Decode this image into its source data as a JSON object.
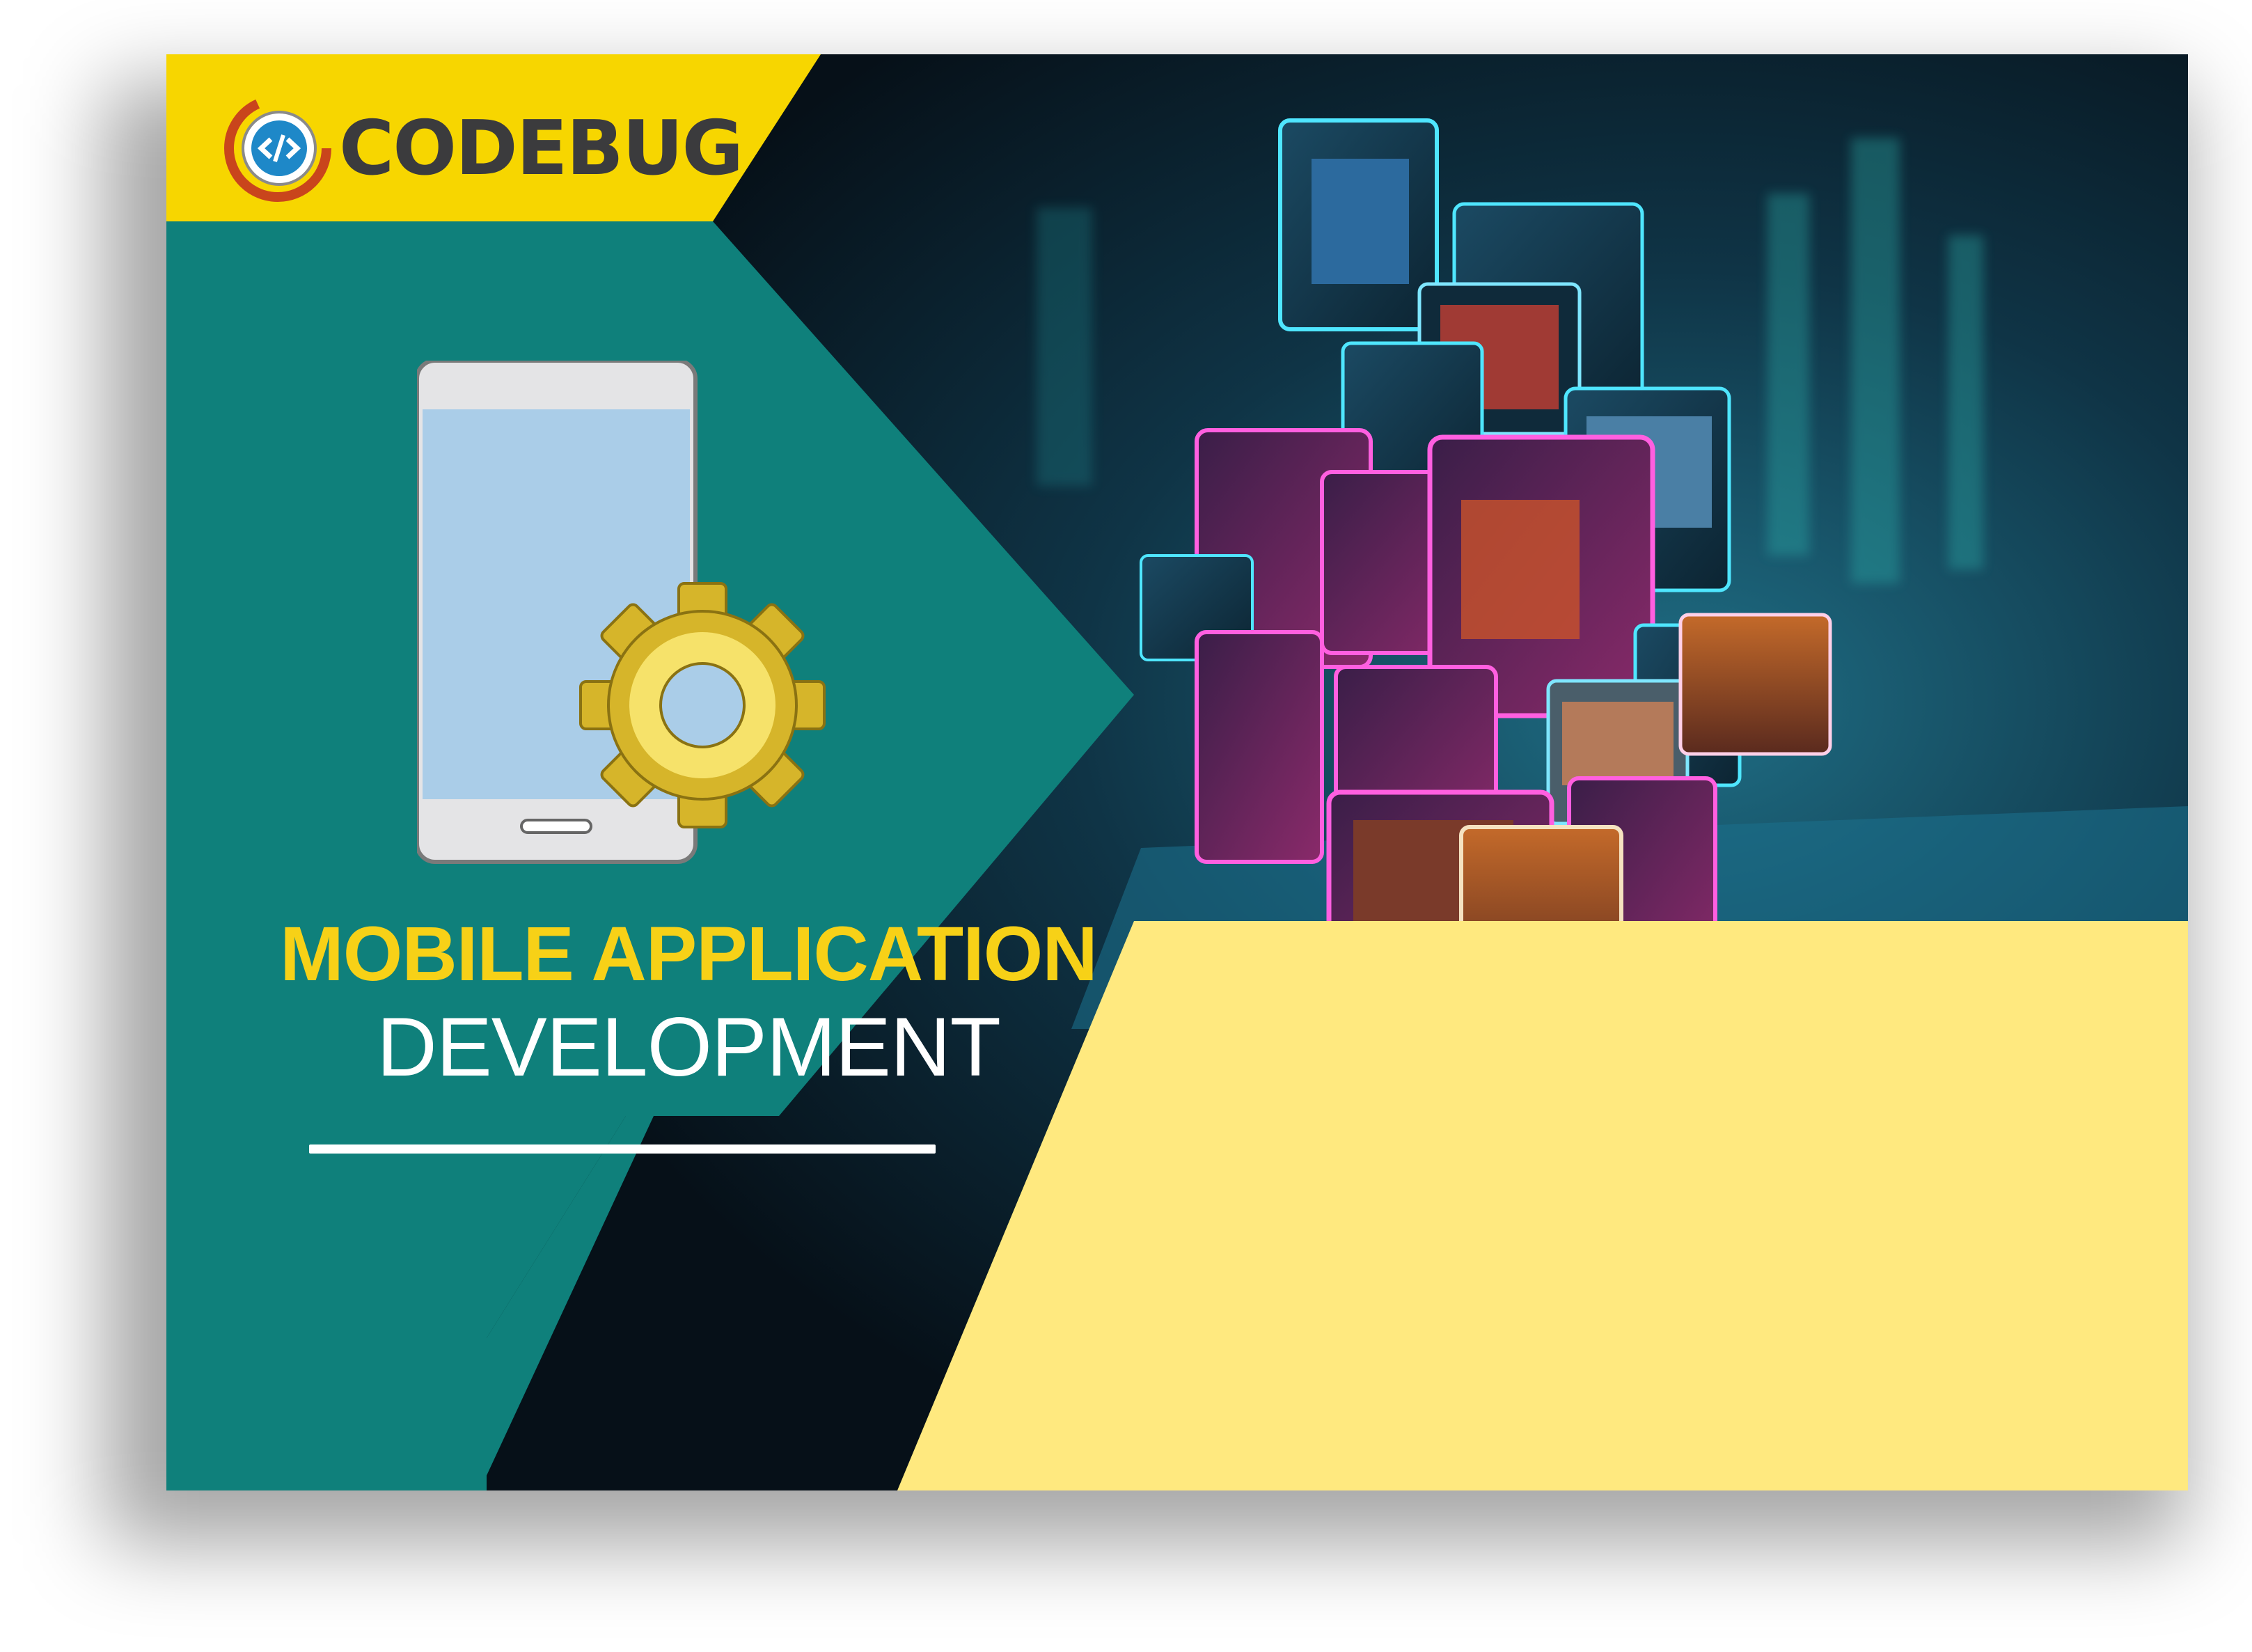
{
  "brand": {
    "name": "CODEBUG",
    "logo_icon": "code-brackets-logo-icon"
  },
  "hero": {
    "title_line1": "MOBILE APPLICATION",
    "title_line2": "DEVELOPMENT",
    "illustration_icon": "smartphone-gear-icon",
    "image_description_icon": "floating-app-screens-image"
  },
  "colors": {
    "teal": "#0f807b",
    "yellow_header": "#f7d600",
    "yellow_panel": "#ffe97f",
    "gold_gear": "#d6b52a",
    "title_yellow": "#f7d117"
  }
}
